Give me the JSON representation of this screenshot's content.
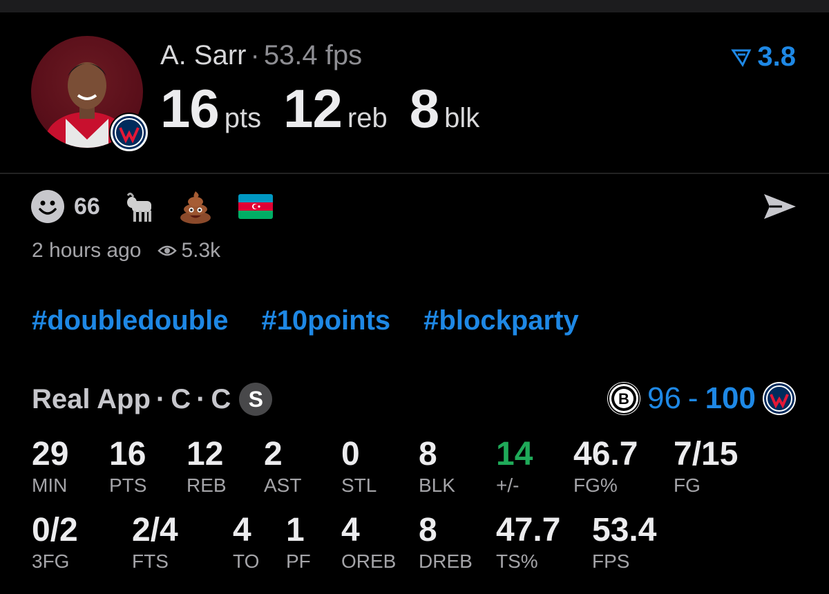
{
  "player": {
    "name": "A. Sarr",
    "fps_label": "53.4 fps",
    "stats": [
      {
        "value": "16",
        "unit": "pts"
      },
      {
        "value": "12",
        "unit": "reb"
      },
      {
        "value": "8",
        "unit": "blk"
      }
    ],
    "rating": "3.8",
    "rating_icon": "filter-triangle-icon",
    "team_badge_icon": "wizards-logo-icon",
    "avatar_icon": "player-photo"
  },
  "reactions": {
    "smiley_count": "66",
    "emojis": [
      "goat-emoji-icon",
      "poop-emoji-icon",
      "azerbaijan-flag-icon"
    ],
    "share_icon": "send-icon"
  },
  "meta": {
    "time": "2 hours ago",
    "views": "5.3k",
    "views_icon": "eye-icon"
  },
  "tags": [
    "#doubledouble",
    "#10points",
    "#blockparty"
  ],
  "game": {
    "app": "Real App",
    "pos1": "C",
    "pos2": "C",
    "badge": "S",
    "score_opp": "96",
    "score_own": "100",
    "opp_logo": "nets-logo-icon",
    "own_logo": "wizards-logo-icon"
  },
  "box_row1": [
    {
      "value": "29",
      "label": "MIN"
    },
    {
      "value": "16",
      "label": "PTS"
    },
    {
      "value": "12",
      "label": "REB"
    },
    {
      "value": "2",
      "label": "AST"
    },
    {
      "value": "0",
      "label": "STL"
    },
    {
      "value": "8",
      "label": "BLK"
    },
    {
      "value": "14",
      "label": "+/-"
    },
    {
      "value": "46.7",
      "label": "FG%"
    },
    {
      "value": "7/15",
      "label": "FG"
    }
  ],
  "box_row2": [
    {
      "value": "0/2",
      "label": "3FG"
    },
    {
      "value": "2/4",
      "label": "FTS"
    },
    {
      "value": "4",
      "label": "TO"
    },
    {
      "value": "1",
      "label": "PF"
    },
    {
      "value": "4",
      "label": "OREB"
    },
    {
      "value": "8",
      "label": "DREB"
    },
    {
      "value": "47.7",
      "label": "TS%"
    },
    {
      "value": "53.4",
      "label": "FPS"
    }
  ],
  "colors": {
    "accent": "#1e88e5",
    "positive": "#1faa59",
    "background": "#000000"
  }
}
